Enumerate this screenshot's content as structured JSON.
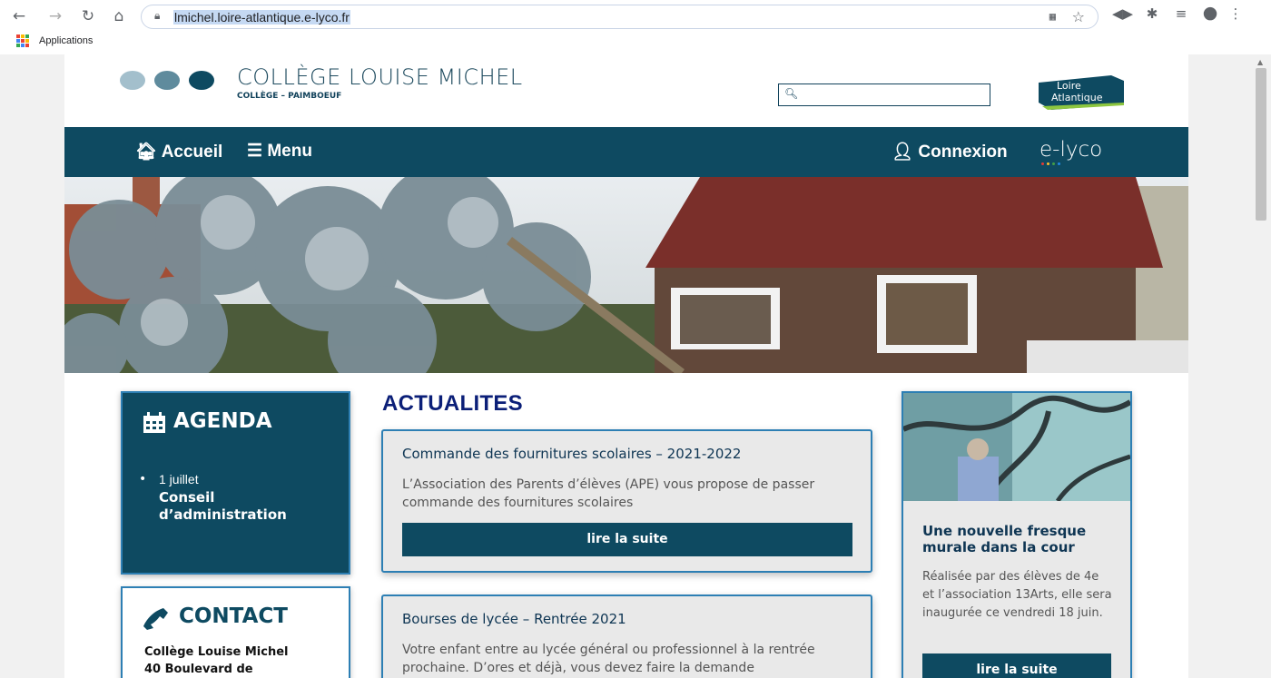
{
  "browser": {
    "url": "lmichel.loire-atlantique.e-lyco.fr",
    "bookmarks_label": "Applications",
    "nav_icons": [
      "back-icon",
      "forward-icon",
      "reload-icon",
      "home-icon"
    ],
    "toolbar_icons": [
      "qr-icon",
      "star-icon",
      "media-icon",
      "extensions-icon",
      "reading-list-icon",
      "profile-icon",
      "menu-icon"
    ]
  },
  "header": {
    "title": "COLLÈGE LOUISE MICHEL",
    "subtitle": "COLLÈGE – PAIMBOEUF",
    "search_value": "",
    "logo_line1": "Loire",
    "logo_line2": "Atlantique"
  },
  "nav": {
    "home": "Accueil",
    "menu": "Menu",
    "login": "Connexion",
    "brand": "e-lyco"
  },
  "agenda": {
    "heading": "AGENDA",
    "items": [
      {
        "date": "1 juillet",
        "title": "Conseil d’administration"
      }
    ]
  },
  "contact": {
    "heading": "CONTACT",
    "line1": "Collège Louise Michel",
    "line2": "40 Boulevard de"
  },
  "news": {
    "heading": "ACTUALITES",
    "articles": [
      {
        "title": "Commande des fournitures scolaires – 2021-2022",
        "excerpt": "L’Association des Parents d’élèves (APE) vous propose de passer commande des fournitures scolaires",
        "button": "lire la suite"
      },
      {
        "title": "Bourses de lycée – Rentrée 2021",
        "excerpt": "Votre enfant entre au lycée général ou professionnel à la rentrée prochaine. D’ores et déjà, vous devez faire la demande",
        "button": "lire la suite"
      }
    ]
  },
  "feature": {
    "title": "Une nouvelle fresque murale dans la cour",
    "excerpt": "Réalisée par des élèves de 4e et l’association 13Arts, elle sera inaugurée ce vendredi 18 juin.",
    "button": "lire la suite"
  },
  "colors": {
    "nav_bg": "#0e4a61",
    "card_border": "#2d7fb4",
    "heading": "#0b1f78"
  }
}
